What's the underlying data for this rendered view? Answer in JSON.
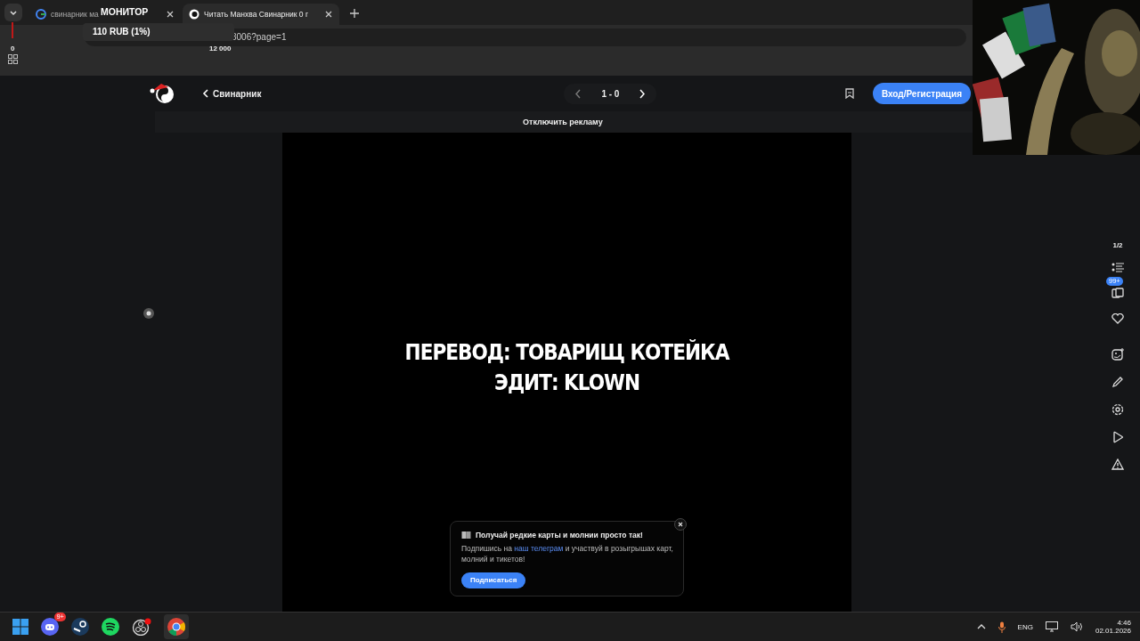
{
  "browser": {
    "tabs": [
      {
        "title": "свинарник ма",
        "selected": false
      },
      {
        "title": "Читать Манхва Свинарник 0 г",
        "selected": true
      }
    ],
    "address": "3006?page=1"
  },
  "stream_overlay": {
    "title": "МОНИТОР",
    "tooltip": "110 RUB (1%)",
    "min": "0",
    "max": "12 000"
  },
  "header": {
    "back_label": "Свинарник",
    "pager": "1 - 0",
    "login": "Вход/Регистрация"
  },
  "ad_bar": "Отключить рекламу",
  "page": {
    "lines": [
      "ПЕРЕВОД: ТОВАРИЩ КОТЕЙКА",
      "ЭДИТ: KLOWN"
    ]
  },
  "rail": {
    "counter": "1/2",
    "badge": "99+"
  },
  "popup": {
    "title": "Получай редкие карты и молнии просто так!",
    "text_before": "Подпишись на",
    "link": "наш телеграм",
    "text_after": "и участвуй в розыгрышах карт, молний и тикетов!",
    "button": "Подписаться"
  },
  "taskbar": {
    "discord_badge": "9+",
    "lang": "ENG",
    "time": "4:46",
    "date": "02.01.2026"
  }
}
